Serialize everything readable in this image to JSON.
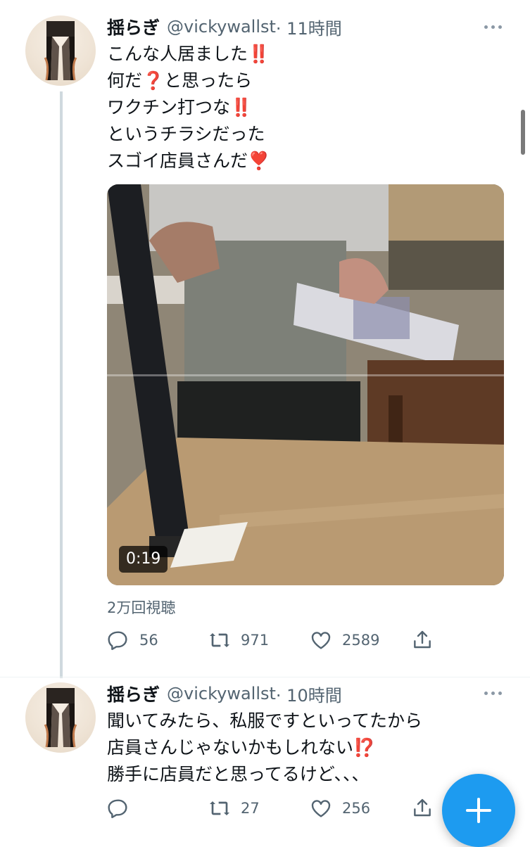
{
  "tweets": [
    {
      "display_name": "揺らぎ",
      "handle": "@vickywallst",
      "time": "· 11時間",
      "lines": [
        "こんな人居ました‼️",
        "何だ❓と思ったら",
        "ワクチン打つな‼️",
        "というチラシだった",
        "スゴイ店員さんだ❣️"
      ],
      "video": {
        "duration": "0:19",
        "views": "2万回視聴"
      },
      "replies": "56",
      "retweets": "971",
      "likes": "2589"
    },
    {
      "display_name": "揺らぎ",
      "handle": "@vickywallst",
      "time": "· 10時間",
      "lines": [
        "聞いてみたら、私服ですといってたから",
        "店員さんじゃないかもしれない⁉️",
        "勝手に店員だと思ってるけど、、、"
      ],
      "replies": "",
      "retweets": "27",
      "likes": "256"
    }
  ],
  "icons": {
    "more": "more-icon",
    "reply": "reply-icon",
    "retweet": "retweet-icon",
    "like": "like-icon",
    "share": "share-icon",
    "compose": "compose-plus-icon"
  },
  "colors": {
    "accent": "#1d9bf0",
    "secondary_text": "#536471",
    "thread_line": "#cfd9de"
  }
}
